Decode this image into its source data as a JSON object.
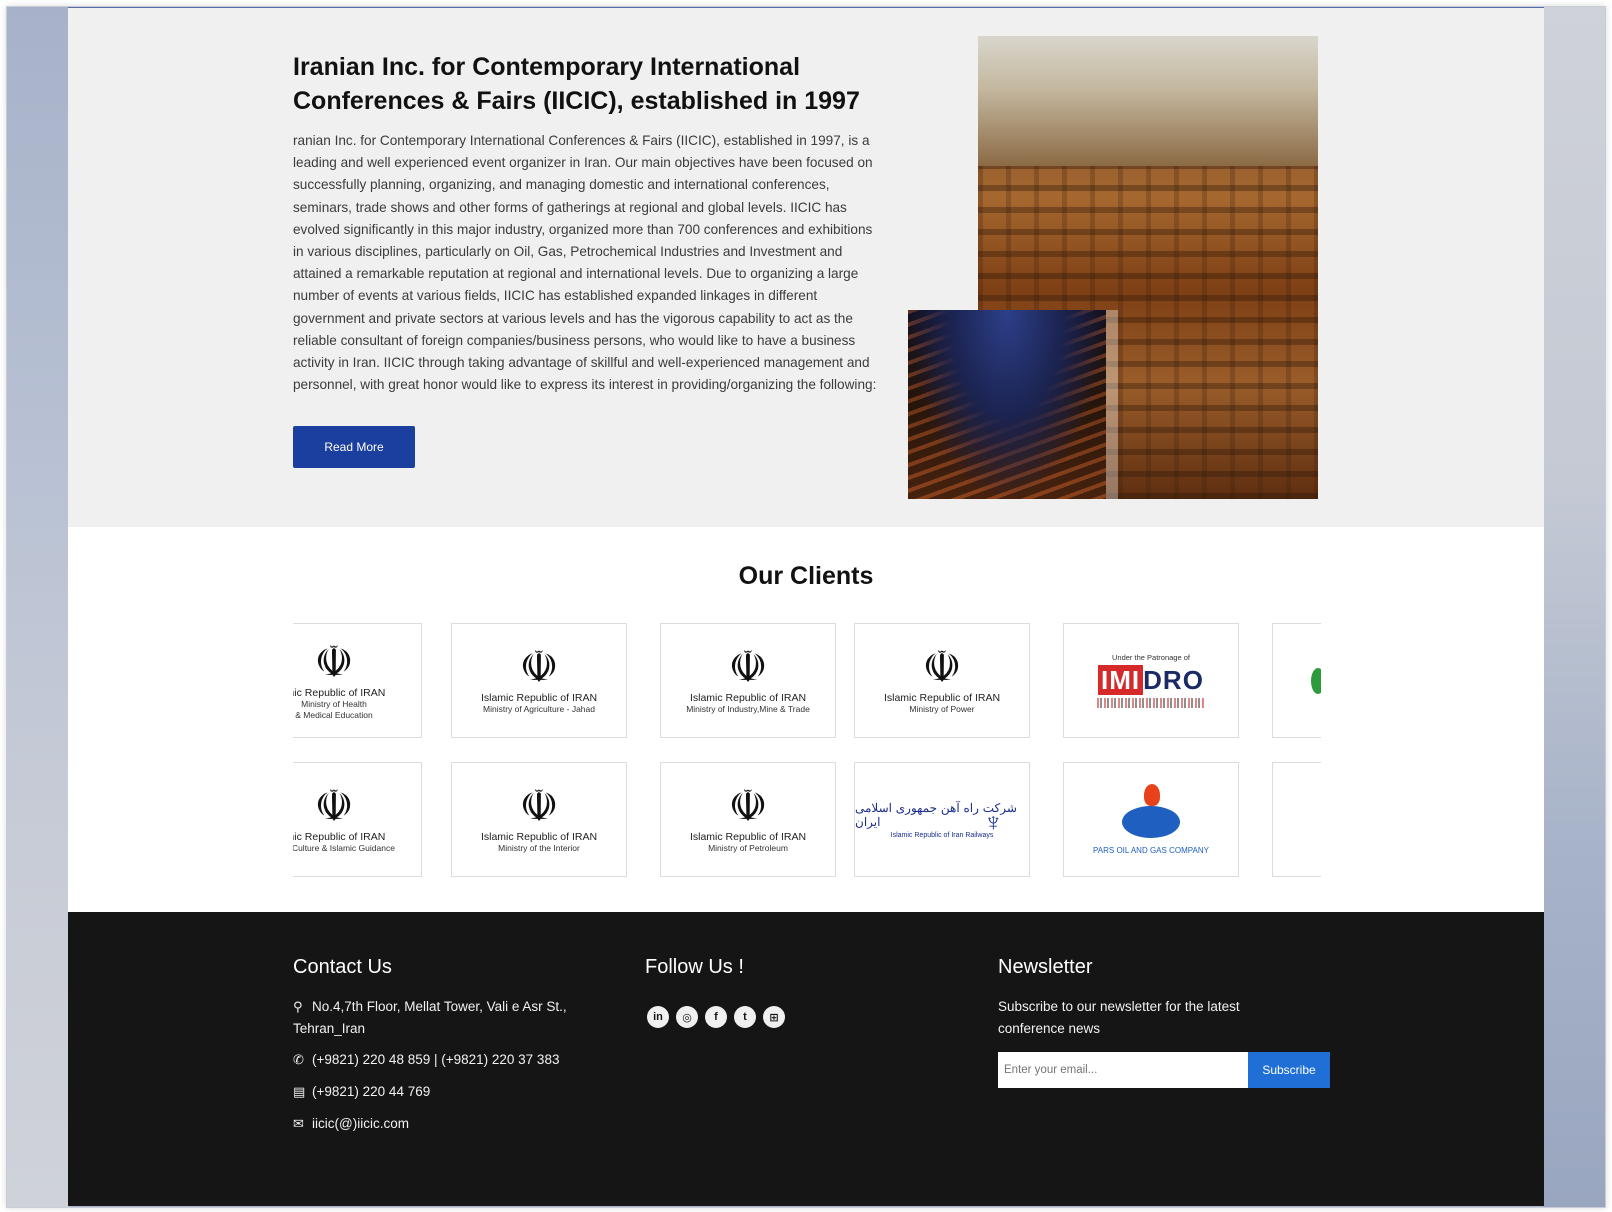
{
  "about": {
    "title": "Iranian Inc. for Contemporary International Conferences & Fairs (IICIC), established in 1997",
    "description": "ranian Inc. for Contemporary International Conferences & Fairs (IICIC), established in 1997, is a leading and well experienced event organizer in Iran. Our main objectives have been focused on successfully planning, organizing, and managing domestic and international conferences, seminars, trade shows and other forms of gatherings at regional and global levels. IICIC has evolved significantly in this major industry, organized more than 700 conferences and exhibitions in various disciplines, particularly on Oil, Gas, Petrochemical Industries and Investment and attained a remarkable reputation at regional and international levels. Due to organizing a large number of events at various fields, IICIC has established expanded linkages in different government and private sectors at various levels and has the vigorous capability to act as the reliable consultant of foreign companies/business persons, who would like to have a business activity in Iran. IICIC through taking advantage of skillful and well-experienced management and personnel, with great honor would like to express its interest in providing/organizing the following:",
    "read_more": "Read More"
  },
  "clients": {
    "title": "Our Clients",
    "row1": [
      {
        "line1": "ımic Republic of IRAN",
        "line2": "Ministry of Health",
        "line3": "& Medical Education"
      },
      {
        "line1": "Islamic Republic of IRAN",
        "line2": "Ministry of Agriculture - Jahad"
      },
      {
        "line1": "Islamic Republic of IRAN",
        "line2": "Ministry of Industry,Mine & Trade"
      },
      {
        "line1": "Islamic Republic of IRAN",
        "line2": "Ministry of Power"
      },
      {
        "top": "Under the Patronage of",
        "logo_a": "IMI",
        "logo_b": "DRO"
      }
    ],
    "row2": [
      {
        "line1": "ımic Republic of IRAN",
        "line2": "ry of Culture & Islamic Guidance"
      },
      {
        "line1": "Islamic Republic of IRAN",
        "line2": "Ministry of the Interior"
      },
      {
        "line1": "Islamic Republic of IRAN",
        "line2": "Ministry of Petroleum"
      },
      {
        "persian": "شرکت راه آهن جمهوری اسلامی ایران",
        "sub": "Islamic Republic of Iran Railways"
      },
      {
        "name": "PARS OIL AND GAS COMPANY"
      }
    ],
    "emblem": "☫"
  },
  "footer": {
    "contact_title": "Contact Us",
    "address_line1": "No.4,7th Floor, Mellat Tower, Vali e Asr St.,",
    "address_line2": "Tehran_Iran",
    "phone": "(+9821) 220 48 859 | (+9821) 220 37 383",
    "fax": "(+9821) 220 44 769",
    "email": "iicic(@)iicic.com",
    "follow_title": "Follow Us !",
    "socials": [
      {
        "name": "linkedin",
        "glyph": "in"
      },
      {
        "name": "instagram",
        "glyph": "◎"
      },
      {
        "name": "facebook",
        "glyph": "f"
      },
      {
        "name": "twitter",
        "glyph": "t"
      },
      {
        "name": "web",
        "glyph": "⊞"
      }
    ],
    "news_title": "Newsletter",
    "news_text": "Subscribe to our newsletter for the latest conference news",
    "email_placeholder": "Enter your email...",
    "subscribe": "Subscribe"
  },
  "colors": {
    "button_blue": "#1b3f9e",
    "subscribe_blue": "#1f6fd6",
    "footer_bg": "#151515",
    "about_bg": "#f0f0f1"
  }
}
